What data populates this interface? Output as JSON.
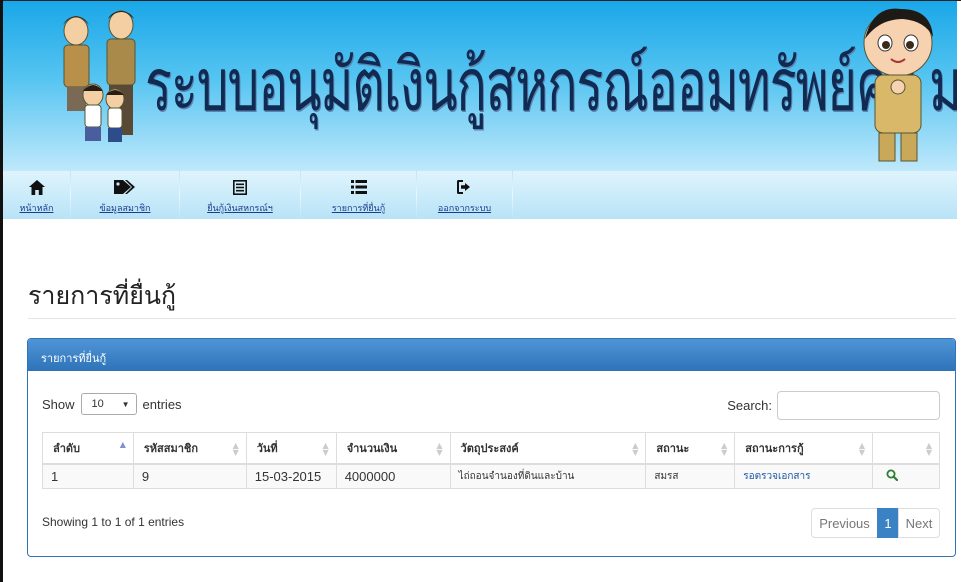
{
  "banner": {
    "title": "ระบบอนุมัติเงินกู้สหกรณ์ออมทรัพย์ครู มหาสารคาม"
  },
  "nav": {
    "items": [
      {
        "label": "หน้าหลัก",
        "icon": "home-icon"
      },
      {
        "label": "ข้อมูลสมาชิก",
        "icon": "tags-icon"
      },
      {
        "label": "ยื่นกู้เงินสหกรณ์ฯ",
        "icon": "list-alt-icon"
      },
      {
        "label": "รายการที่ยื่นกู้",
        "icon": "list-icon"
      },
      {
        "label": "ออกจากระบบ",
        "icon": "log-out-icon"
      }
    ]
  },
  "page": {
    "title": "รายการที่ยื่นกู้"
  },
  "panel": {
    "heading": "รายการที่ยื่นกู้",
    "show_label": "Show",
    "length_value": "10",
    "entries_label": "entries",
    "search_label": "Search:",
    "search_value": "",
    "columns": [
      "ลำดับ",
      "รหัสสมาชิก",
      "วันที่",
      "จำนวนเงิน",
      "วัตถุประสงค์",
      "สถานะ",
      "สถานะการกู้",
      ""
    ],
    "rows": [
      {
        "no": "1",
        "member_id": "9",
        "date": "15-03-2015",
        "amount": "4000000",
        "purpose": "ไถ่ถอนจำนองที่ดินและบ้าน",
        "status": "สมรส",
        "loan_status": "รอตรวจเอกสาร",
        "action_icon": "search-icon"
      }
    ],
    "info": "Showing 1 to 1 of 1 entries",
    "pager": {
      "previous": "Previous",
      "current": "1",
      "next": "Next"
    }
  },
  "colors": {
    "banner_top": "#1aa7e8",
    "panel_heading": "#337ab7",
    "link": "#1b56a8",
    "pager_active": "#3b82c4"
  }
}
